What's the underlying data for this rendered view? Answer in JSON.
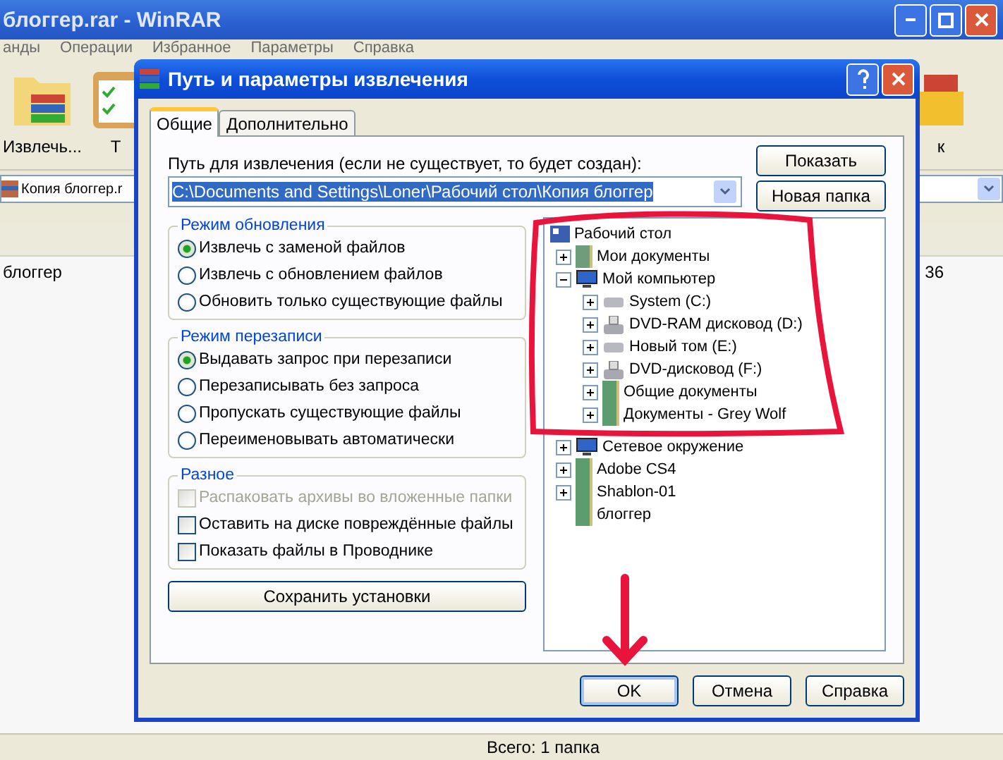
{
  "window": {
    "title": "блоггер.rar - WinRAR",
    "menu": [
      "анды",
      "Операции",
      "Избранное",
      "Параметры",
      "Справка"
    ],
    "toolbar": [
      {
        "label": "Извлечь...",
        "kind": "extract"
      },
      {
        "label": "Т",
        "kind": "test"
      },
      {
        "label": "к",
        "kind": "box"
      }
    ],
    "address": "Копия блоггер.r",
    "files": [
      {
        "name": "блоггер",
        "column_2": "36"
      }
    ],
    "status_bar": "Всего: 1 папка"
  },
  "dialog": {
    "title": "Путь и параметры извлечения",
    "tabs": [
      {
        "label": "Общие",
        "selected": true
      },
      {
        "label": "Дополнительно",
        "selected": false
      }
    ],
    "path_label": "Путь для извлечения (если не существует, то будет создан):",
    "path_value": "C:\\Documents and Settings\\Loner\\Рабочий стол\\Копия блоггер",
    "side_buttons": [
      "Показать",
      "Новая папка"
    ],
    "groups": [
      {
        "title": "Режим обновления",
        "options": [
          {
            "kind": "radio",
            "label": "Извлечь с заменой файлов",
            "selected": true,
            "disabled": false
          },
          {
            "kind": "radio",
            "label": "Извлечь с обновлением файлов",
            "selected": false,
            "disabled": false
          },
          {
            "kind": "radio",
            "label": "Обновить только существующие файлы",
            "selected": false,
            "disabled": false
          }
        ]
      },
      {
        "title": "Режим перезаписи",
        "options": [
          {
            "kind": "radio",
            "label": "Выдавать запрос при перезаписи",
            "selected": true,
            "disabled": false
          },
          {
            "kind": "radio",
            "label": "Перезаписывать без запроса",
            "selected": false,
            "disabled": false
          },
          {
            "kind": "radio",
            "label": "Пропускать существующие файлы",
            "selected": false,
            "disabled": false
          },
          {
            "kind": "radio",
            "label": "Переименовывать автоматически",
            "selected": false,
            "disabled": false
          }
        ]
      },
      {
        "title": "Разное",
        "options": [
          {
            "kind": "checkbox",
            "label": "Распаковать архивы во вложенные папки",
            "checked": false,
            "disabled": true
          },
          {
            "kind": "checkbox",
            "label": "Оставить на диске повреждённые файлы",
            "checked": false,
            "disabled": false
          },
          {
            "kind": "checkbox",
            "label": "Показать файлы в Проводнике",
            "checked": false,
            "disabled": false
          }
        ]
      }
    ],
    "save_button": "Сохранить установки",
    "tree": [
      {
        "label": "Рабочий стол",
        "kind": "desktop",
        "children": [
          {
            "label": "Мои документы",
            "kind": "documents",
            "expanded": false
          },
          {
            "label": "Мой компьютер",
            "kind": "computer",
            "expanded": true,
            "children": [
              {
                "label": "System (C:)",
                "kind": "drive",
                "expanded": false
              },
              {
                "label": "DVD-RAM дисковод (D:)",
                "kind": "dvd",
                "expanded": false
              },
              {
                "label": "Новый том (E:)",
                "kind": "drive",
                "expanded": false
              },
              {
                "label": "DVD-дисковод (F:)",
                "kind": "dvd",
                "expanded": false
              },
              {
                "label": "Общие документы",
                "kind": "folder",
                "expanded": false
              },
              {
                "label": "Документы - Grey Wolf",
                "kind": "folder",
                "expanded": false
              }
            ]
          },
          {
            "label": "Сетевое окружение",
            "kind": "network",
            "expanded": false
          },
          {
            "label": "Adobe CS4",
            "kind": "folder",
            "expanded": false
          },
          {
            "label": "Shablon-01",
            "kind": "folder",
            "expanded": false
          },
          {
            "label": "блоггер",
            "kind": "folder"
          }
        ]
      }
    ],
    "buttons": [
      {
        "label": "OK",
        "selected": true
      },
      {
        "label": "Отмена",
        "selected": false
      },
      {
        "label": "Справка",
        "selected": false
      }
    ]
  }
}
